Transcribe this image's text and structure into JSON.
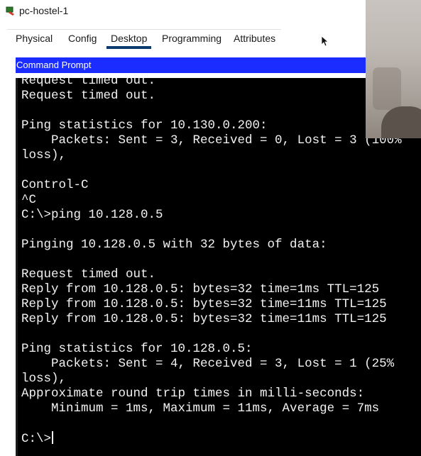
{
  "window": {
    "title": "pc-hostel-1"
  },
  "tabs": [
    {
      "label": "Physical"
    },
    {
      "label": "Config"
    },
    {
      "label": "Desktop"
    },
    {
      "label": "Programming"
    },
    {
      "label": "Attributes"
    }
  ],
  "active_tab": "Desktop",
  "panel": {
    "title": "Command Prompt"
  },
  "terminal": {
    "lines": [
      "Request timed out.",
      "Request timed out.",
      "",
      "Ping statistics for 10.130.0.200:",
      "    Packets: Sent = 3, Received = 0, Lost = 3 (100%",
      "loss),",
      "",
      "Control-C",
      "^C",
      "C:\\>ping 10.128.0.5",
      "",
      "Pinging 10.128.0.5 with 32 bytes of data:",
      "",
      "Request timed out.",
      "Reply from 10.128.0.5: bytes=32 time=1ms TTL=125",
      "Reply from 10.128.0.5: bytes=32 time=11ms TTL=125",
      "Reply from 10.128.0.5: bytes=32 time=11ms TTL=125",
      "",
      "Ping statistics for 10.128.0.5:",
      "    Packets: Sent = 4, Received = 3, Lost = 1 (25%",
      "loss),",
      "Approximate round trip times in milli-seconds:",
      "    Minimum = 1ms, Maximum = 11ms, Average = 7ms",
      "",
      "C:\\>"
    ]
  },
  "colors": {
    "panel_header": "#1a2cff",
    "terminal_bg": "#000000",
    "terminal_fg": "#f2f2f2",
    "active_tab_underline": "#0b3a6e"
  },
  "icons": {
    "app": "packet-tracer-pc-icon",
    "cursor": "mouse-pointer-icon"
  }
}
